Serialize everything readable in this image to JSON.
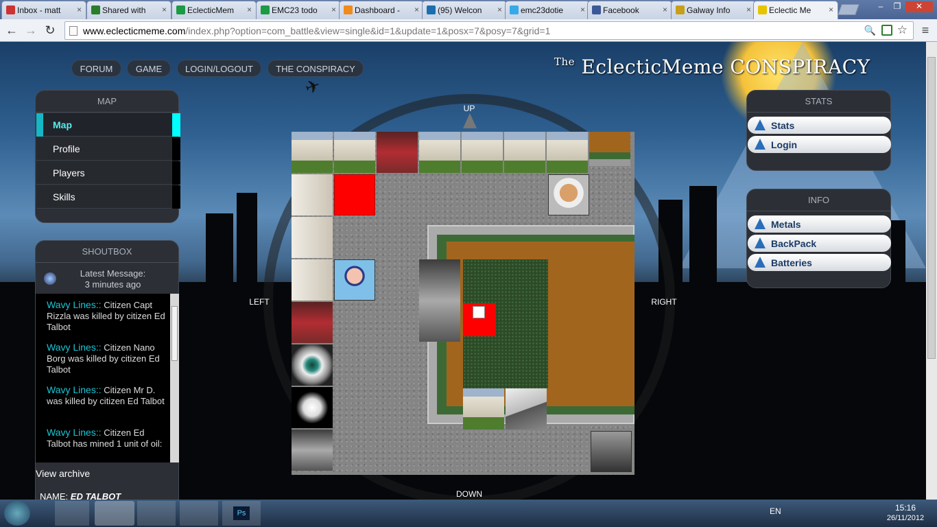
{
  "tabs": [
    {
      "label": "Inbox - matt",
      "fav": "#c33"
    },
    {
      "label": "Shared with",
      "fav": "#2a7d2a"
    },
    {
      "label": "EclecticMem",
      "fav": "#1c9a44"
    },
    {
      "label": "EMC23 todo",
      "fav": "#1c9a44"
    },
    {
      "label": "Dashboard -",
      "fav": "#f08a1c"
    },
    {
      "label": "(95) Welcon",
      "fav": "#1a6fb0"
    },
    {
      "label": "emc23dotie",
      "fav": "#37a9e8"
    },
    {
      "label": "Facebook",
      "fav": "#3b5998"
    },
    {
      "label": "Galway Info",
      "fav": "#c7a019"
    },
    {
      "label": "Eclectic Me",
      "fav": "#e6c400"
    }
  ],
  "tab_close": "×",
  "toolbar": {
    "back": "←",
    "forward": "→",
    "reload": "↻",
    "url_host": "www.eclecticmeme.com",
    "url_path": "/index.php?option=com_battle&view=single&id=1&update=1&posx=7&posy=7&grid=1",
    "zoom_icon": "🔍",
    "star_icon": "☆",
    "menu_icon": "≡"
  },
  "site": {
    "logo_prefix": "The",
    "logo_text": "EclecticMeme CONSPIRACY"
  },
  "nav": [
    "FORUM",
    "GAME",
    "LOGIN/LOGOUT",
    "THE CONSPIRACY"
  ],
  "map_panel": {
    "title": "MAP",
    "items": [
      "Map",
      "Profile",
      "Players",
      "Skills"
    ]
  },
  "shoutbox": {
    "title": "SHOUTBOX",
    "latest_label": "Latest Message:",
    "latest_time": "3 minutes ago",
    "messages": [
      {
        "who": "Wavy Lines::",
        "text": " Citizen Capt Rizzla was killed by citizen Ed Talbot"
      },
      {
        "who": "Wavy Lines::",
        "text": " Citizen Nano Borg was killed by citizen Ed Talbot"
      },
      {
        "who": "Wavy Lines::",
        "text": " Citizen Mr D. was killed by citizen Ed Talbot"
      },
      {
        "who": "Wavy Lines::",
        "text": " Citizen Ed Talbot has mined 1 unit of oil:"
      }
    ],
    "view_archive": "View archive",
    "name_label": "NAME:",
    "name_value": "ED TALBOT"
  },
  "stats_panel": {
    "title": "STATS",
    "items": [
      "Stats",
      "Login"
    ]
  },
  "info_panel": {
    "title": "INFO",
    "items": [
      "Metals",
      "BackPack",
      "Batteries"
    ]
  },
  "directions": {
    "up": "UP",
    "down": "DOWN",
    "left": "LEFT",
    "right": "RIGHT"
  },
  "taskbar": {
    "lang": "EN",
    "time": "15:16",
    "date": "26/11/2012",
    "ps": "Ps"
  }
}
